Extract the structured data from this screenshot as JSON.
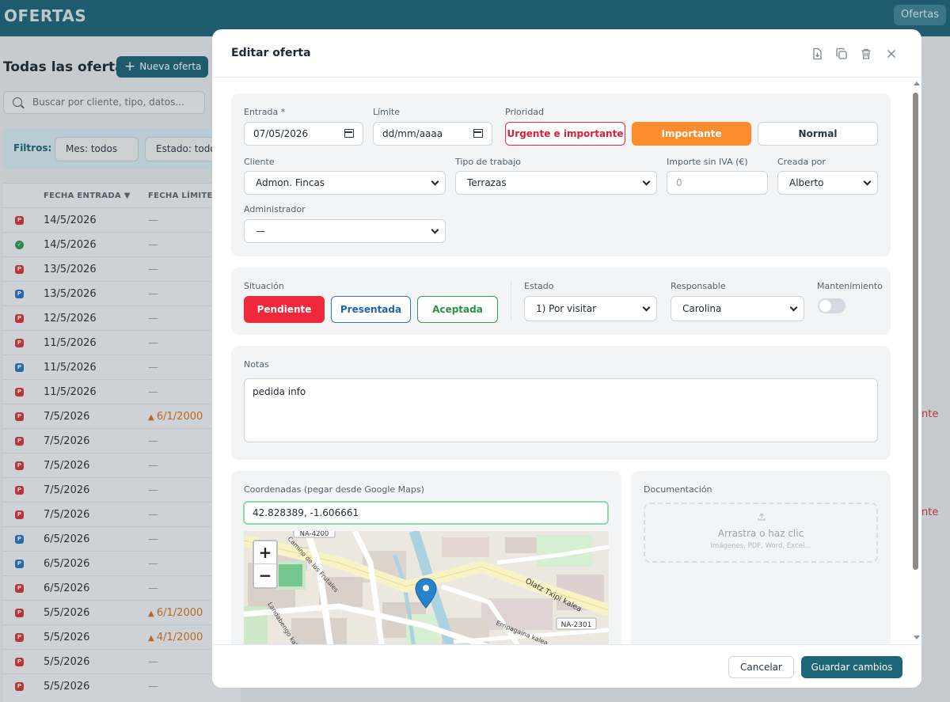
{
  "app": {
    "title": "OFERTAS",
    "top_pill": "Ofertas"
  },
  "list": {
    "title": "Todas las ofertas",
    "new_button": "Nueva oferta",
    "search_placeholder": "Buscar por cliente, tipo, datos...",
    "filters_label": "Filtros:",
    "filter_month": "Mes: todos",
    "filter_state": "Estado: todos",
    "col_entry": "FECHA ENTRADA",
    "col_limit": "FECHA LÍMITE",
    "rows": [
      {
        "badge": "P",
        "date": "14/5/2026",
        "limit": "—"
      },
      {
        "badge": "OK",
        "date": "14/5/2026",
        "limit": "—"
      },
      {
        "badge": "P",
        "date": "13/5/2026",
        "limit": "—"
      },
      {
        "badge": "P",
        "date": "13/5/2026",
        "limit": "—"
      },
      {
        "badge": "P",
        "date": "12/5/2026",
        "limit": "—"
      },
      {
        "badge": "P",
        "date": "11/5/2026",
        "limit": "—"
      },
      {
        "badge": "P",
        "date": "11/5/2026",
        "limit": "—"
      },
      {
        "badge": "P",
        "date": "11/5/2026",
        "limit": "—"
      },
      {
        "badge": "P",
        "date": "7/5/2026",
        "limit": "6/1/2000",
        "warn": true
      },
      {
        "badge": "P",
        "date": "7/5/2026",
        "limit": "—"
      },
      {
        "badge": "P",
        "date": "7/5/2026",
        "limit": "—"
      },
      {
        "badge": "P",
        "date": "7/5/2026",
        "limit": "—"
      },
      {
        "badge": "P",
        "date": "7/5/2026",
        "limit": "—"
      },
      {
        "badge": "P",
        "date": "6/5/2026",
        "limit": "—"
      },
      {
        "badge": "P",
        "date": "6/5/2026",
        "limit": "—"
      },
      {
        "badge": "P",
        "date": "6/5/2026",
        "limit": "—"
      },
      {
        "badge": "P",
        "date": "5/5/2026",
        "limit": "6/1/2000",
        "warn": true
      },
      {
        "badge": "P",
        "date": "5/5/2026",
        "limit": "4/1/2000",
        "warn": true
      },
      {
        "badge": "P",
        "date": "5/5/2026",
        "limit": "—"
      },
      {
        "badge": "P",
        "date": "5/5/2026",
        "limit": "—"
      }
    ],
    "side_fragment": "nte"
  },
  "modal": {
    "title": "Editar oferta",
    "entrada_label": "Entrada *",
    "entrada_value": "07/05/2026",
    "limite_label": "Límite",
    "limite_value": "dd/mm/aaaa",
    "prioridad_label": "Prioridad",
    "prio_urgent": "Urgente e importante",
    "prio_important": "Importante",
    "prio_normal": "Normal",
    "cliente_label": "Cliente",
    "cliente_value": "Admon. Fincas",
    "tipo_label": "Tipo de trabajo",
    "tipo_value": "Terrazas",
    "importe_label": "Importe sin IVA (€)",
    "importe_placeholder": "0",
    "creada_label": "Creada por",
    "creada_value": "Alberto",
    "admin_label": "Administrador",
    "admin_value": "—",
    "situacion_label": "Situación",
    "sit_pendiente": "Pendiente",
    "sit_presentada": "Presentada",
    "sit_aceptada": "Aceptada",
    "estado_label": "Estado",
    "estado_value": "1) Por visitar",
    "responsable_label": "Responsable",
    "responsable_value": "Carolina",
    "mantenimiento_label": "Mantenimiento",
    "mantenimiento_on": false,
    "notas_label": "Notas",
    "notas_value": "pedida info",
    "coords_label": "Coordenadas (pegar desde Google Maps)",
    "coords_value": "42.828389, -1.606661",
    "map_labels": {
      "na4200": "NA-4200",
      "na2301": "NA-2301",
      "olatz": "Olatz Txipi kalea",
      "frutales": "Camino de los Frutales",
      "landaben": "Landabengo kalea",
      "erripagaina": "Erripagaina kalea"
    },
    "zoom_in": "+",
    "zoom_out": "−",
    "doc_label": "Documentación",
    "drop_text": "Arrastra o haz clic",
    "drop_hint": "Imágenes, PDF, Word, Excel...",
    "cancel": "Cancelar",
    "save": "Guardar cambios"
  },
  "colors": {
    "brand": "#1d6578",
    "urgent": "#f0283c",
    "important": "#fb8c2e",
    "accepted": "#2f9e4f",
    "presented": "#2b74c7"
  },
  "icons": [
    "search-icon",
    "plus-icon",
    "download-icon",
    "copy-icon",
    "trash-icon",
    "close-icon",
    "calendar-icon",
    "chevron-down-icon",
    "map-pin-icon",
    "upload-icon",
    "warning-icon"
  ]
}
